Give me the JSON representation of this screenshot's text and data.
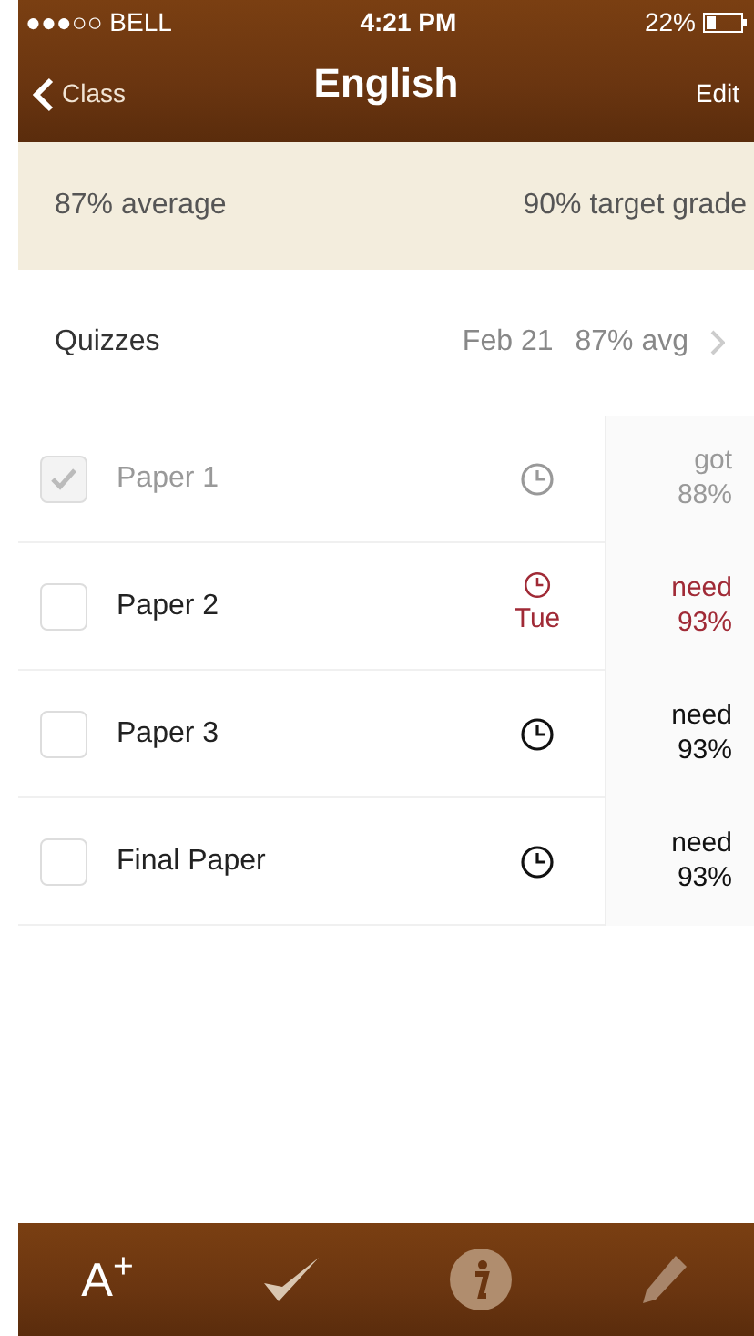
{
  "status_bar": {
    "carrier": "●●●○○ BELL",
    "time": "4:21 PM",
    "battery": "22%"
  },
  "nav": {
    "back": "Class",
    "title": "English",
    "action": "Edit"
  },
  "summary": {
    "average": "87% average",
    "target": "90% target grade"
  },
  "category": {
    "name": "Quizzes",
    "date": "Feb 21",
    "average": "87% avg"
  },
  "assignments": [
    {
      "name": "Paper 1",
      "checked": true,
      "urgent": false,
      "result_label": "got",
      "result_value": "88%"
    },
    {
      "name": "Paper 2",
      "checked": false,
      "urgent": true,
      "due": "Tue",
      "result_label": "need",
      "result_value": "93%"
    },
    {
      "name": "Paper 3",
      "checked": false,
      "urgent": false,
      "result_label": "need",
      "result_value": "93%"
    },
    {
      "name": "Final Paper",
      "checked": false,
      "urgent": false,
      "result_label": "need",
      "result_value": "93%"
    }
  ],
  "toolbar": {
    "grade_label": "A$^{+}$"
  }
}
